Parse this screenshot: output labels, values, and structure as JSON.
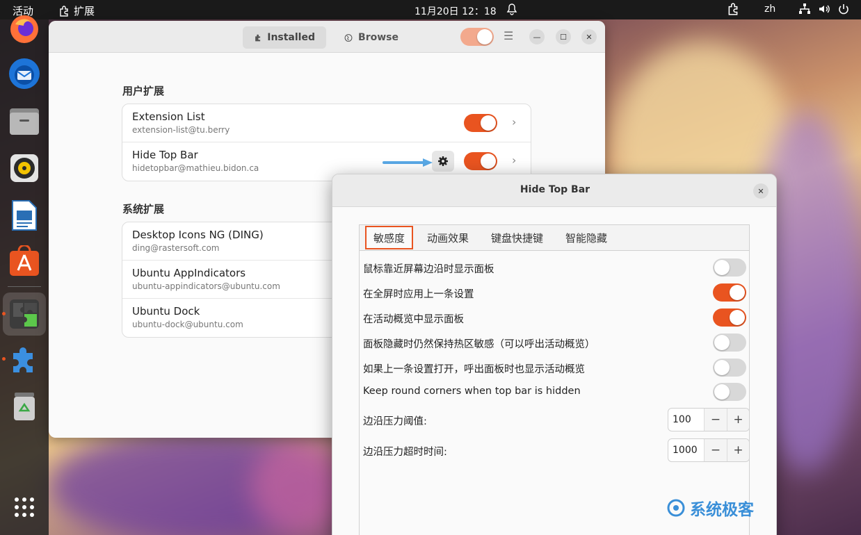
{
  "topbar": {
    "activities": "活动",
    "app_name": "扩展",
    "clock": "11月20日  12：18",
    "lang": "zh"
  },
  "dock": {
    "items": [
      {
        "name": "firefox-icon"
      },
      {
        "name": "thunderbird-icon"
      },
      {
        "name": "files-icon"
      },
      {
        "name": "rhythmbox-icon"
      },
      {
        "name": "libreoffice-writer-icon"
      },
      {
        "name": "app-center-icon"
      },
      {
        "name": "extension-manager-icon"
      },
      {
        "name": "extensions-icon"
      },
      {
        "name": "trash-icon"
      },
      {
        "name": "show-apps-icon"
      }
    ]
  },
  "main_window": {
    "tabs": {
      "installed": "Installed",
      "browse": "Browse"
    },
    "user_section_title": "用户扩展",
    "system_section_title": "系统扩展",
    "user_extensions": [
      {
        "name": "Extension List",
        "id": "extension-list@tu.berry",
        "enabled": true
      },
      {
        "name": "Hide Top Bar",
        "id": "hidetopbar@mathieu.bidon.ca",
        "enabled": true
      }
    ],
    "system_extensions": [
      {
        "name": "Desktop Icons NG (DING)",
        "id": "ding@rastersoft.com"
      },
      {
        "name": "Ubuntu AppIndicators",
        "id": "ubuntu-appindicators@ubuntu.com"
      },
      {
        "name": "Ubuntu Dock",
        "id": "ubuntu-dock@ubuntu.com"
      }
    ]
  },
  "dialog": {
    "title": "Hide Top Bar",
    "tabs": [
      "敏感度",
      "动画效果",
      "键盘快捷键",
      "智能隐藏"
    ],
    "options": [
      {
        "label": "鼠标靠近屏幕边沿时显示面板",
        "enabled": false
      },
      {
        "label": "在全屏时应用上一条设置",
        "enabled": true
      },
      {
        "label": "在活动概览中显示面板",
        "enabled": true
      },
      {
        "label": "面板隐藏时仍然保持热区敏感（可以呼出活动概览）",
        "enabled": false
      },
      {
        "label": "如果上一条设置打开，呼出面板时也显示活动概览",
        "enabled": false
      },
      {
        "label": "Keep round corners when top bar is hidden",
        "enabled": false
      }
    ],
    "spinners": [
      {
        "label": "边沿压力阈值:",
        "value": "100",
        "minus": "−",
        "plus": "+"
      },
      {
        "label": "边沿压力超时时间:",
        "value": "1000",
        "minus": "−",
        "plus": "+"
      }
    ]
  },
  "watermark": "系统极客",
  "colors": {
    "accent": "#e95420",
    "panel": "#1a1a1a"
  }
}
